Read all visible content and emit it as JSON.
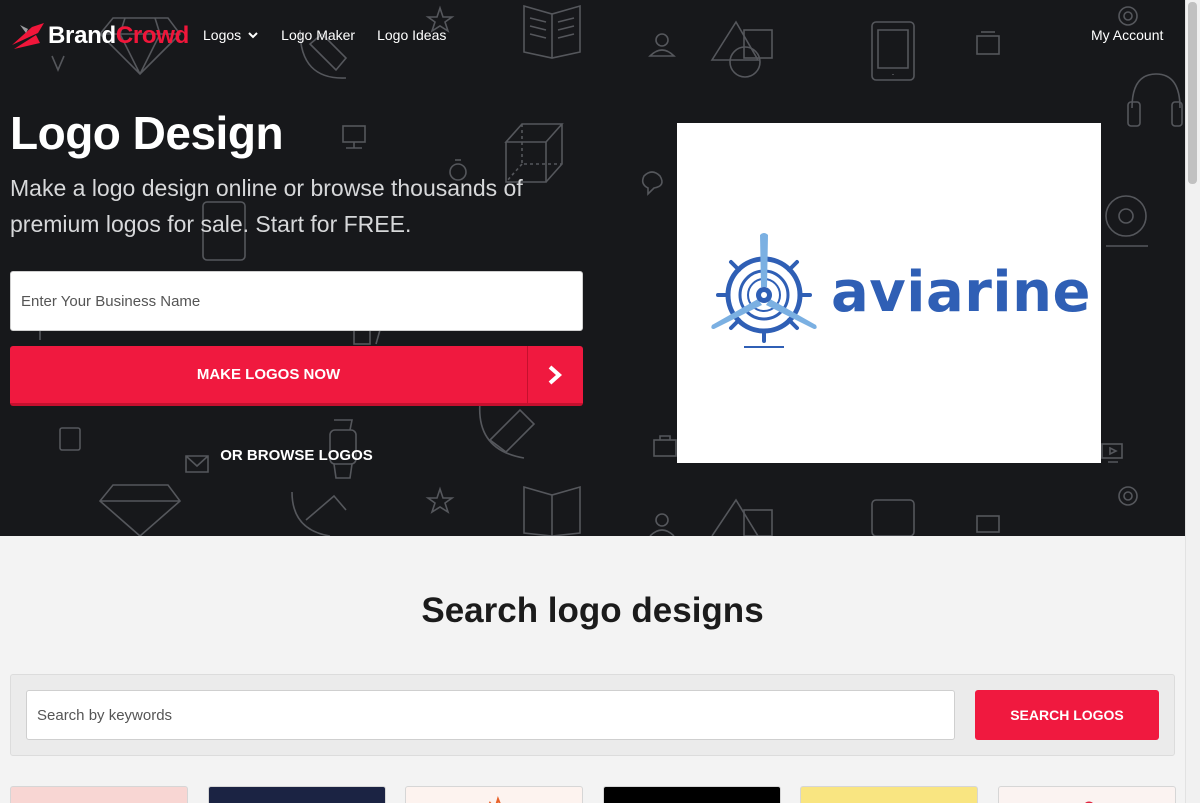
{
  "brand": {
    "name_part1": "Brand",
    "name_part2": "Crowd",
    "primary_color": "#f0163a",
    "dark_bg": "#17181b"
  },
  "nav": {
    "items": [
      {
        "label": "Logos",
        "has_dropdown": true
      },
      {
        "label": "Logo Maker"
      },
      {
        "label": "Logo Ideas"
      }
    ],
    "account_label": "My Account"
  },
  "hero": {
    "title": "Logo Design",
    "subtitle": "Make a logo design online or browse thousands of premium logos for sale. Start for FREE.",
    "business_input": {
      "placeholder": "Enter Your Business Name",
      "value": ""
    },
    "make_button_label": "MAKE LOGOS NOW",
    "browse_link_label": "OR BROWSE LOGOS"
  },
  "featured_logo": {
    "text": "aviarine",
    "color": "#2f5fb5",
    "icon": "ship-wheel-propeller-icon"
  },
  "search": {
    "title": "Search logo designs",
    "input": {
      "placeholder": "Search by keywords",
      "value": ""
    },
    "button_label": "SEARCH LOGOS"
  },
  "thumbnails": [
    {
      "bg": "#f8d6d3"
    },
    {
      "bg": "#1b2343"
    },
    {
      "bg": "#fdf3ef"
    },
    {
      "bg": "#000000"
    },
    {
      "bg": "#f9e581"
    },
    {
      "bg": "#fbf3f1"
    }
  ]
}
